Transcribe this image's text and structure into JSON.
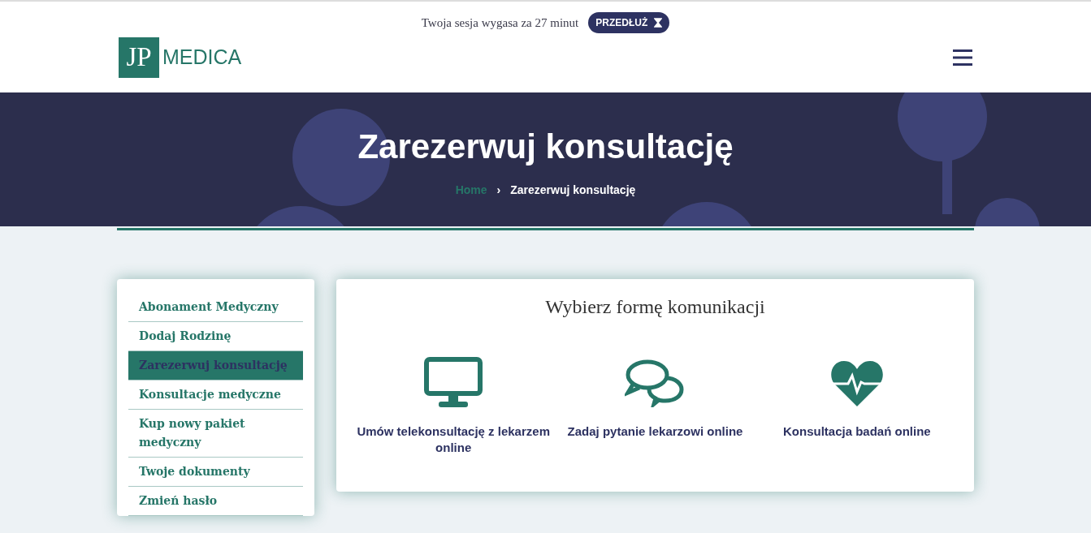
{
  "session_bar": {
    "text": "Twoja sesja wygasa za 27 minut",
    "button": "PRZEDŁUŻ"
  },
  "logo": {
    "initials": "JP",
    "name": "MEDICA"
  },
  "hero": {
    "title": "Zarezerwuj konsultację",
    "breadcrumbs": [
      "Home",
      "Zarezerwuj konsultację"
    ],
    "separator": "›"
  },
  "sidebar": {
    "items": [
      {
        "label": "Abonament Medyczny",
        "selected": false
      },
      {
        "label": "Dodaj Rodzinę",
        "selected": false
      },
      {
        "label": "Zarezerwuj konsultację",
        "selected": true
      },
      {
        "label": "Konsultacje medyczne",
        "selected": false
      },
      {
        "label": "Kup nowy pakiet medyczny",
        "selected": false
      },
      {
        "label": "Twoje dokumenty",
        "selected": false
      },
      {
        "label": "Zmień hasło",
        "selected": false
      }
    ]
  },
  "panel": {
    "title": "Wybierz formę komunikacji",
    "options": [
      {
        "kind": "monitor",
        "label": "Umów telekonsultację z lekarzem online"
      },
      {
        "kind": "chat",
        "label": "Zadaj pytanie lekarzowi online"
      },
      {
        "kind": "heart",
        "label": "Konsultacja badań online"
      }
    ]
  }
}
